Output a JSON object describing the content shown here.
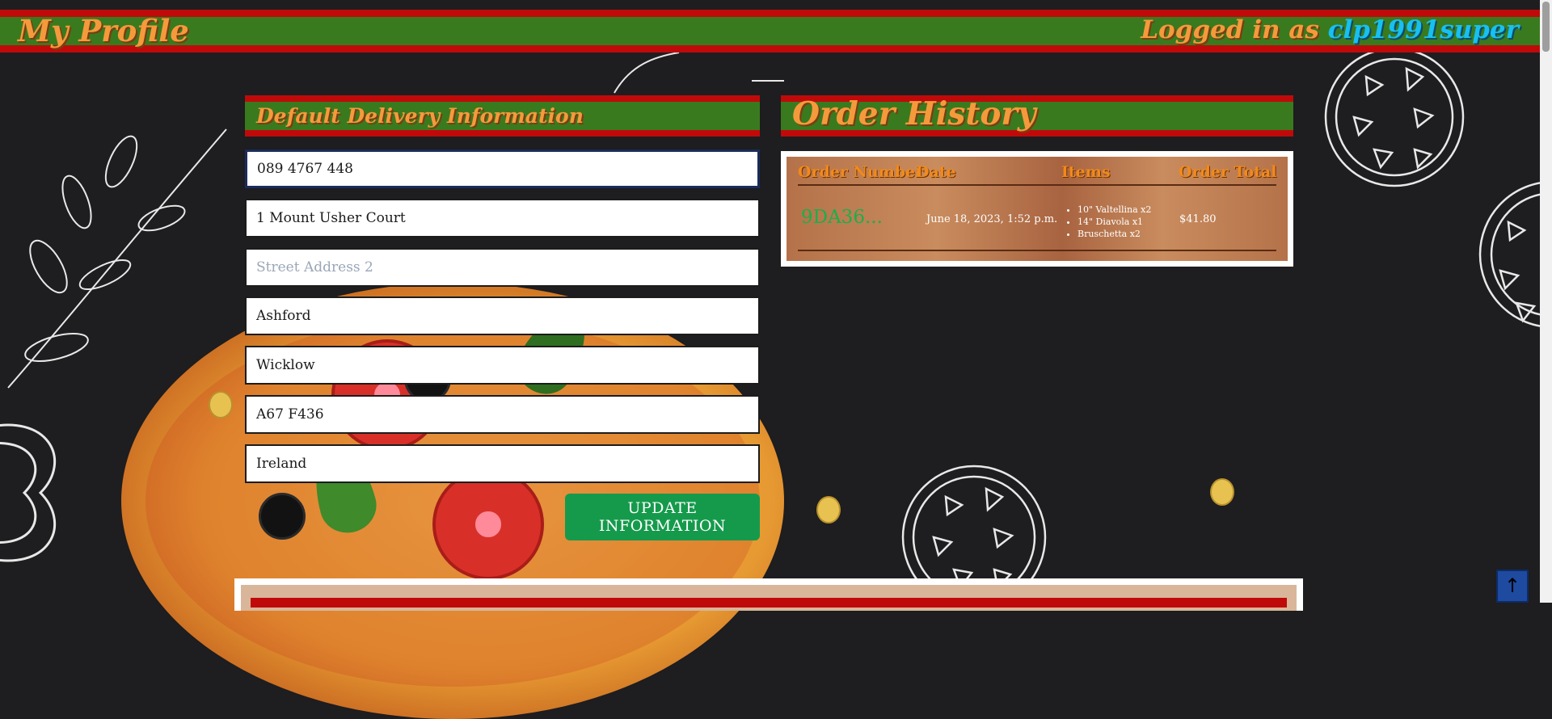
{
  "header": {
    "title": "My Profile",
    "login_prefix": "Logged in as ",
    "username": "clp1991super"
  },
  "delivery": {
    "heading": "Default Delivery Information",
    "phone": "089 4767 448",
    "street1": "1 Mount Usher Court",
    "street2_placeholder": "Street Address 2",
    "town": "Ashford",
    "county": "Wicklow",
    "postcode": "A67 F436",
    "country": "Ireland",
    "update_label": "UPDATE INFORMATION"
  },
  "orders": {
    "heading": "Order History",
    "columns": [
      "Order Number",
      "Date",
      "Items",
      "Order Total"
    ],
    "rows": [
      {
        "number": "9DA36...",
        "date": "June 18, 2023, 1:52 p.m.",
        "items": [
          "10\" Valtellina x2",
          "14\" Diavola x1",
          "Bruschetta x2"
        ],
        "total": "$41.80"
      }
    ]
  },
  "icons": {
    "back_to_top": "arrow-up-icon"
  },
  "colors": {
    "accent_orange": "#f59a3c",
    "header_green": "#3a7a1e",
    "header_red": "#c00a0a",
    "username_blue": "#17c0f0",
    "button_green": "#159a4c"
  }
}
